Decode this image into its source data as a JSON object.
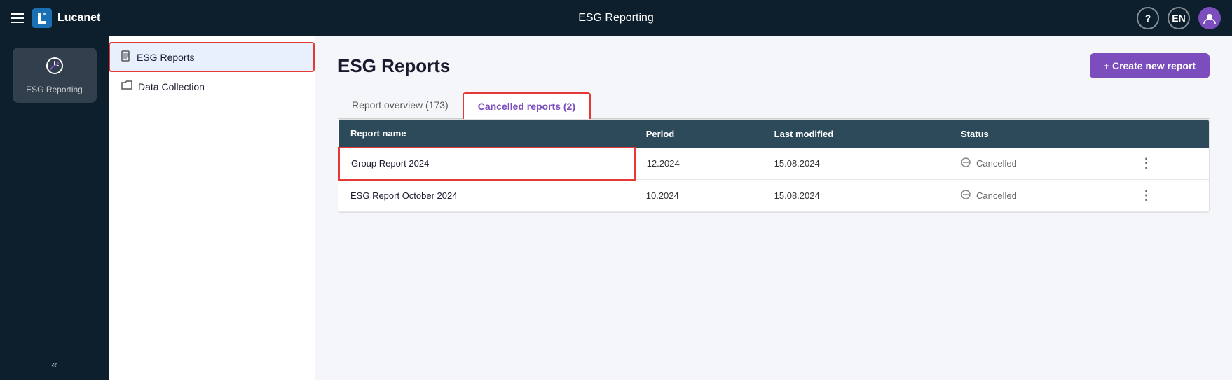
{
  "app": {
    "title": "ESG Reporting",
    "logo_text": "Lucanet"
  },
  "topnav": {
    "title": "ESG Reporting",
    "help_label": "?",
    "lang_label": "EN"
  },
  "sidebar_main": {
    "item_icon": "↻",
    "item_label": "ESG Reporting"
  },
  "nav_sidebar": {
    "items": [
      {
        "label": "ESG Reports",
        "icon": "📄",
        "active": true
      },
      {
        "label": "Data Collection",
        "icon": "📁",
        "active": false
      }
    ],
    "collapse_icon": "«"
  },
  "content": {
    "page_title": "ESG Reports",
    "create_button": "+ Create new report",
    "tabs": [
      {
        "label": "Report overview (173)",
        "active": false
      },
      {
        "label": "Cancelled reports (2)",
        "active": true
      }
    ],
    "table": {
      "columns": [
        "Report name",
        "Period",
        "Last modified",
        "Status"
      ],
      "rows": [
        {
          "name": "Group Report 2024",
          "period": "12.2024",
          "last_modified": "15.08.2024",
          "status": "Cancelled",
          "highlight": true
        },
        {
          "name": "ESG Report October 2024",
          "period": "10.2024",
          "last_modified": "15.08.2024",
          "status": "Cancelled",
          "highlight": false
        }
      ]
    }
  }
}
